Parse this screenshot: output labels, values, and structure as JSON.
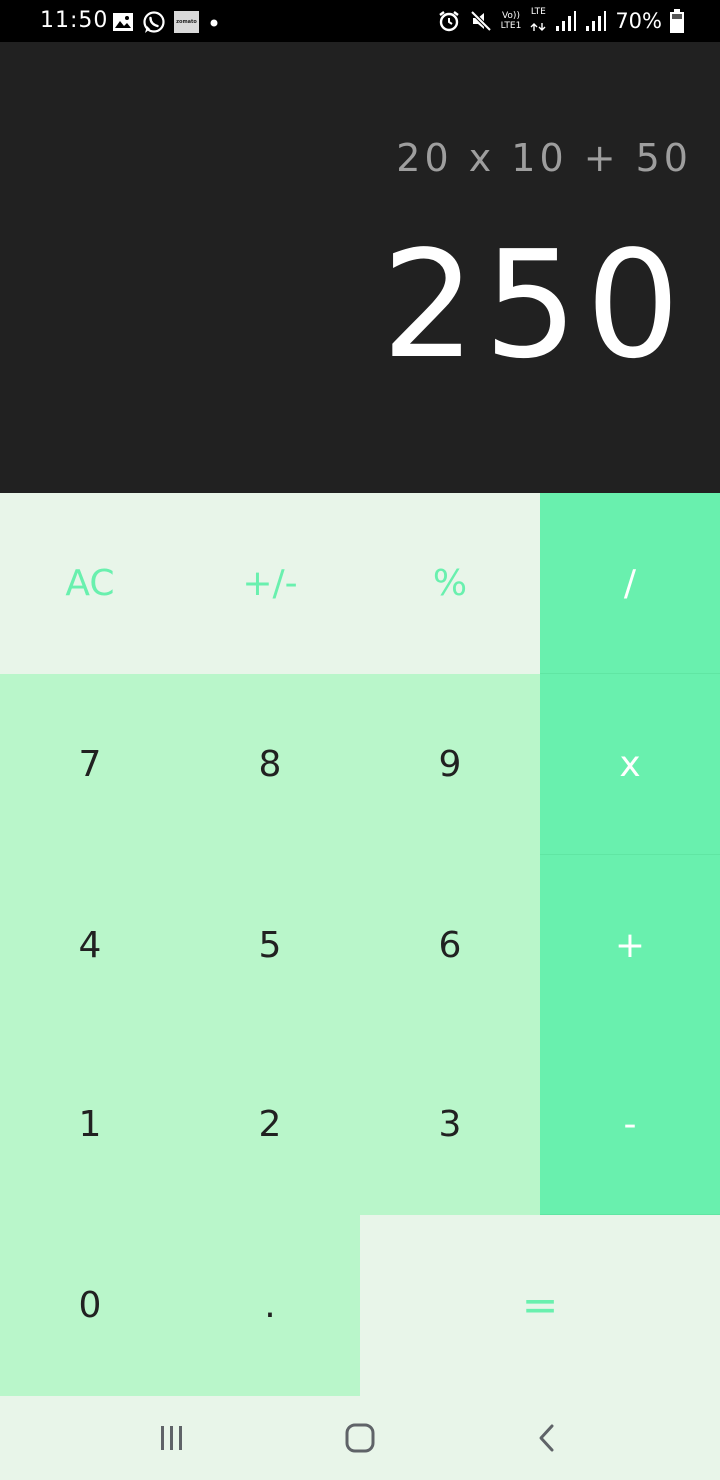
{
  "status_bar": {
    "time": "11:50",
    "battery": "70%",
    "network_top": "Vo))",
    "network_bottom": "LTE1",
    "lte_label": "LTE",
    "zomato_label": "zomato",
    "left_icons": [
      "gallery-icon",
      "whatsapp-icon",
      "zomato-icon",
      "dot-icon"
    ],
    "right_icons": [
      "alarm-icon",
      "mute-icon",
      "volte-icon",
      "lte-icon",
      "signal-icon",
      "signal-icon",
      "battery-icon"
    ]
  },
  "display": {
    "expression": "20 x 10 + 50",
    "result": "250"
  },
  "keypad": {
    "ac": "AC",
    "sign": "+/-",
    "percent": "%",
    "divide": "/",
    "seven": "7",
    "eight": "8",
    "nine": "9",
    "multiply": "x",
    "four": "4",
    "five": "5",
    "six": "6",
    "plus": "+",
    "one": "1",
    "two": "2",
    "three": "3",
    "minus": "-",
    "zero": "0",
    "decimal": ".",
    "equals": "="
  },
  "nav_bar": {
    "icons": [
      "recent-apps-icon",
      "home-icon",
      "back-icon"
    ]
  },
  "colors": {
    "display_bg": "#212121",
    "function_bg": "#e8f5e9",
    "number_bg": "#b9f6ca",
    "operator_bg": "#69f0ae",
    "accent_text": "#69f0ae"
  }
}
